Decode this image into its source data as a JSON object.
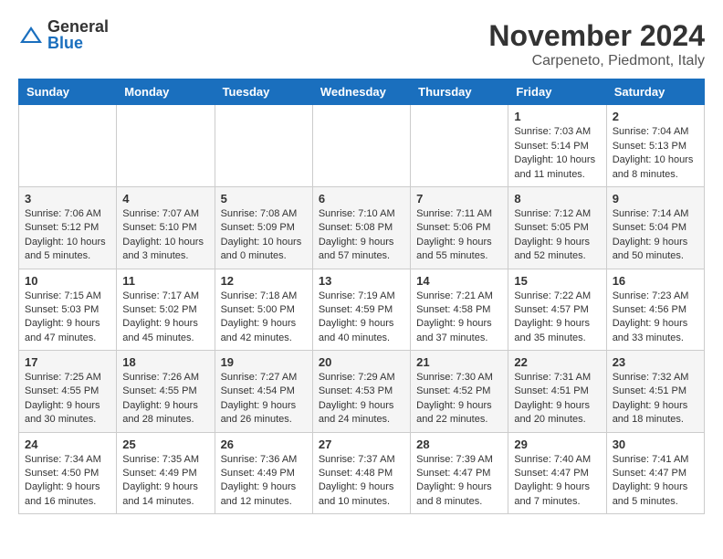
{
  "header": {
    "logo_general": "General",
    "logo_blue": "Blue",
    "month_title": "November 2024",
    "location": "Carpeneto, Piedmont, Italy"
  },
  "weekdays": [
    "Sunday",
    "Monday",
    "Tuesday",
    "Wednesday",
    "Thursday",
    "Friday",
    "Saturday"
  ],
  "weeks": [
    [
      {
        "day": "",
        "info": ""
      },
      {
        "day": "",
        "info": ""
      },
      {
        "day": "",
        "info": ""
      },
      {
        "day": "",
        "info": ""
      },
      {
        "day": "",
        "info": ""
      },
      {
        "day": "1",
        "info": "Sunrise: 7:03 AM\nSunset: 5:14 PM\nDaylight: 10 hours and 11 minutes."
      },
      {
        "day": "2",
        "info": "Sunrise: 7:04 AM\nSunset: 5:13 PM\nDaylight: 10 hours and 8 minutes."
      }
    ],
    [
      {
        "day": "3",
        "info": "Sunrise: 7:06 AM\nSunset: 5:12 PM\nDaylight: 10 hours and 5 minutes."
      },
      {
        "day": "4",
        "info": "Sunrise: 7:07 AM\nSunset: 5:10 PM\nDaylight: 10 hours and 3 minutes."
      },
      {
        "day": "5",
        "info": "Sunrise: 7:08 AM\nSunset: 5:09 PM\nDaylight: 10 hours and 0 minutes."
      },
      {
        "day": "6",
        "info": "Sunrise: 7:10 AM\nSunset: 5:08 PM\nDaylight: 9 hours and 57 minutes."
      },
      {
        "day": "7",
        "info": "Sunrise: 7:11 AM\nSunset: 5:06 PM\nDaylight: 9 hours and 55 minutes."
      },
      {
        "day": "8",
        "info": "Sunrise: 7:12 AM\nSunset: 5:05 PM\nDaylight: 9 hours and 52 minutes."
      },
      {
        "day": "9",
        "info": "Sunrise: 7:14 AM\nSunset: 5:04 PM\nDaylight: 9 hours and 50 minutes."
      }
    ],
    [
      {
        "day": "10",
        "info": "Sunrise: 7:15 AM\nSunset: 5:03 PM\nDaylight: 9 hours and 47 minutes."
      },
      {
        "day": "11",
        "info": "Sunrise: 7:17 AM\nSunset: 5:02 PM\nDaylight: 9 hours and 45 minutes."
      },
      {
        "day": "12",
        "info": "Sunrise: 7:18 AM\nSunset: 5:00 PM\nDaylight: 9 hours and 42 minutes."
      },
      {
        "day": "13",
        "info": "Sunrise: 7:19 AM\nSunset: 4:59 PM\nDaylight: 9 hours and 40 minutes."
      },
      {
        "day": "14",
        "info": "Sunrise: 7:21 AM\nSunset: 4:58 PM\nDaylight: 9 hours and 37 minutes."
      },
      {
        "day": "15",
        "info": "Sunrise: 7:22 AM\nSunset: 4:57 PM\nDaylight: 9 hours and 35 minutes."
      },
      {
        "day": "16",
        "info": "Sunrise: 7:23 AM\nSunset: 4:56 PM\nDaylight: 9 hours and 33 minutes."
      }
    ],
    [
      {
        "day": "17",
        "info": "Sunrise: 7:25 AM\nSunset: 4:55 PM\nDaylight: 9 hours and 30 minutes."
      },
      {
        "day": "18",
        "info": "Sunrise: 7:26 AM\nSunset: 4:55 PM\nDaylight: 9 hours and 28 minutes."
      },
      {
        "day": "19",
        "info": "Sunrise: 7:27 AM\nSunset: 4:54 PM\nDaylight: 9 hours and 26 minutes."
      },
      {
        "day": "20",
        "info": "Sunrise: 7:29 AM\nSunset: 4:53 PM\nDaylight: 9 hours and 24 minutes."
      },
      {
        "day": "21",
        "info": "Sunrise: 7:30 AM\nSunset: 4:52 PM\nDaylight: 9 hours and 22 minutes."
      },
      {
        "day": "22",
        "info": "Sunrise: 7:31 AM\nSunset: 4:51 PM\nDaylight: 9 hours and 20 minutes."
      },
      {
        "day": "23",
        "info": "Sunrise: 7:32 AM\nSunset: 4:51 PM\nDaylight: 9 hours and 18 minutes."
      }
    ],
    [
      {
        "day": "24",
        "info": "Sunrise: 7:34 AM\nSunset: 4:50 PM\nDaylight: 9 hours and 16 minutes."
      },
      {
        "day": "25",
        "info": "Sunrise: 7:35 AM\nSunset: 4:49 PM\nDaylight: 9 hours and 14 minutes."
      },
      {
        "day": "26",
        "info": "Sunrise: 7:36 AM\nSunset: 4:49 PM\nDaylight: 9 hours and 12 minutes."
      },
      {
        "day": "27",
        "info": "Sunrise: 7:37 AM\nSunset: 4:48 PM\nDaylight: 9 hours and 10 minutes."
      },
      {
        "day": "28",
        "info": "Sunrise: 7:39 AM\nSunset: 4:47 PM\nDaylight: 9 hours and 8 minutes."
      },
      {
        "day": "29",
        "info": "Sunrise: 7:40 AM\nSunset: 4:47 PM\nDaylight: 9 hours and 7 minutes."
      },
      {
        "day": "30",
        "info": "Sunrise: 7:41 AM\nSunset: 4:47 PM\nDaylight: 9 hours and 5 minutes."
      }
    ]
  ]
}
